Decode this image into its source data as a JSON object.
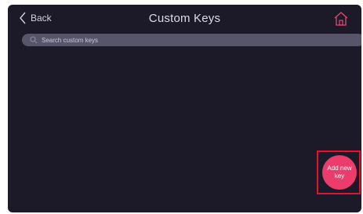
{
  "header": {
    "back_label": "Back",
    "title": "Custom Keys",
    "home_icon": "home-icon"
  },
  "search": {
    "placeholder": "Search custom keys",
    "value": ""
  },
  "fab": {
    "label": "Add new key"
  },
  "colors": {
    "background": "#1c1a29",
    "search_bar": "#575569",
    "accent": "#ec3c6b",
    "highlight": "#e2142e"
  }
}
